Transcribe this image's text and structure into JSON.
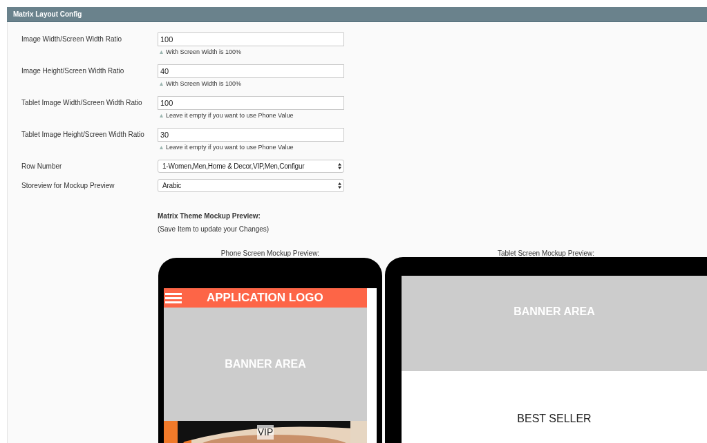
{
  "panel": {
    "title": "Matrix Layout Config"
  },
  "fields": [
    {
      "kind": "text",
      "label": "Image Width/Screen Width Ratio",
      "value": "100",
      "hint": "With Screen Width is 100%"
    },
    {
      "kind": "text",
      "label": "Image Height/Screen Width Ratio",
      "value": "40",
      "hint": "With Screen Width is 100%"
    },
    {
      "kind": "text",
      "label": "Tablet Image Width/Screen Width Ratio",
      "value": "100",
      "hint": "Leave it empty if you want to use Phone Value"
    },
    {
      "kind": "text",
      "label": "Tablet Image Height/Screen Width Ratio",
      "value": "30",
      "hint": "Leave it empty if you want to use Phone Value"
    },
    {
      "kind": "select",
      "label": "Row Number",
      "value": "1-Women,Men,Home & Decor,VIP,Men,Configur"
    },
    {
      "kind": "select",
      "label": "Storeview for Mockup Preview",
      "value": "Arabic"
    }
  ],
  "preview": {
    "heading": "Matrix Theme Mockup Preview:",
    "note": "(Save Item to update your Changes)",
    "phone": {
      "caption": "Phone Screen Mockup Preview:",
      "app_bar": "APPLICATION LOGO",
      "banner": "BANNER AREA",
      "tile_label": "VIP"
    },
    "tablet": {
      "caption": "Tablet Screen Mockup Preview:",
      "banner": "BANNER AREA",
      "section": "BEST SELLER"
    }
  }
}
